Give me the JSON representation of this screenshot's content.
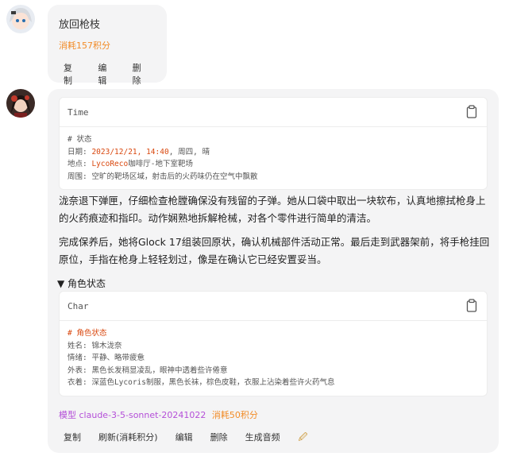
{
  "user_message": {
    "text": "放回枪枝",
    "cost": "消耗157积分",
    "actions": [
      "复制",
      "编辑",
      "删除"
    ]
  },
  "ai_message": {
    "time_block": {
      "lang": "Time",
      "comment": "# 状态",
      "date_label": "日期: ",
      "date_value": "2023/12/21, 14:40",
      "date_rest": ", 周四, 晴",
      "loc_label": "地点: ",
      "loc_value": "LycoReco",
      "loc_rest": "咖啡厅-地下室靶场",
      "env": "周围: 空旷的靶场区域，射击后的火药味仍在空气中飘散"
    },
    "paragraph1": "泷奈退下弹匣，仔细检查枪膛确保没有残留的子弹。她从口袋中取出一块软布，认真地擦拭枪身上的火药痕迹和指印。动作娴熟地拆解枪械，对各个零件进行简单的清洁。",
    "paragraph2": "完成保养后，她将Glock 17组装回原状，确认机械部件活动正常。最后走到武器架前，将手枪挂回原位，手指在枪身上轻轻划过，像是在确认它已经安置妥当。",
    "details_summary": "▼ 角色状态",
    "char_block": {
      "lang": "Char",
      "comment": "# 角色状态",
      "lines": [
        "姓名: 锦木泷奈",
        "情绪: 平静、略带疲惫",
        "外表: 黑色长发稍显凌乱，眼神中透着些许倦意",
        "衣着: 深蓝色Lycoris制服，黑色长袜，棕色皮鞋，衣服上沾染着些许火药气息"
      ]
    },
    "model_label": "模型",
    "model_name": "claude-3-5-sonnet-20241022",
    "cost": "消耗50积分",
    "actions": [
      "复制",
      "刷新(消耗积分)",
      "编辑",
      "删除",
      "生成音频"
    ],
    "pencil_icon": "🖉"
  },
  "colors": {
    "accent_orange": "#f28c28",
    "accent_purple": "#b44fd8",
    "highlight": "#d9480f"
  }
}
